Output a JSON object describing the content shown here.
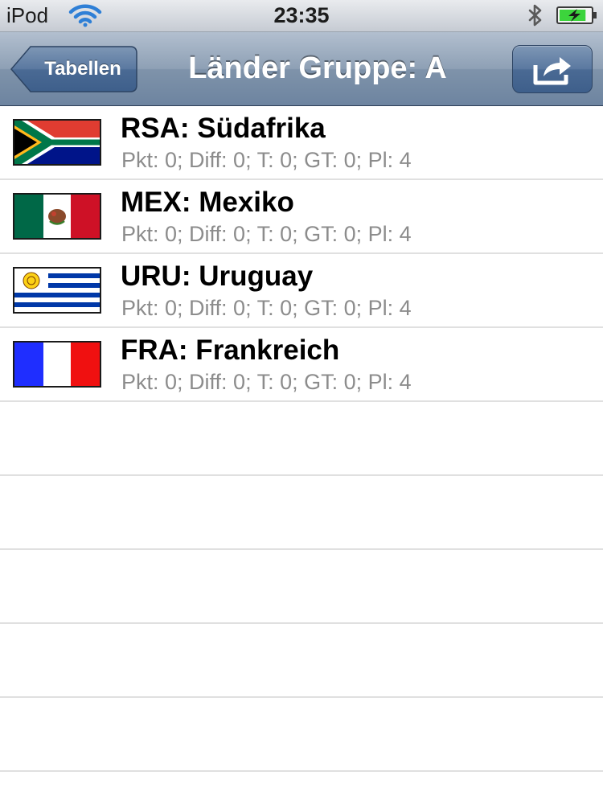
{
  "status_bar": {
    "carrier": "iPod",
    "time": "23:35",
    "wifi_icon": "wifi-icon",
    "bluetooth_icon": "bluetooth-icon",
    "battery_icon": "battery-charging-icon",
    "battery_level": 0.85
  },
  "nav_bar": {
    "back_label": "Tabellen",
    "title": "Länder Gruppe: A",
    "action_icon": "share-icon"
  },
  "teams": [
    {
      "name": "RSA: Südafrika",
      "stats": "Pkt: 0; Diff: 0; T: 0; GT: 0; Pl: 4",
      "flag_icon": "south-africa-flag-icon"
    },
    {
      "name": "MEX: Mexiko",
      "stats": "Pkt: 0; Diff: 0; T: 0; GT: 0; Pl: 4",
      "flag_icon": "mexico-flag-icon"
    },
    {
      "name": "URU: Uruguay",
      "stats": "Pkt: 0; Diff: 0; T: 0; GT: 0; Pl: 4",
      "flag_icon": "uruguay-flag-icon"
    },
    {
      "name": "FRA: Frankreich",
      "stats": "Pkt: 0; Diff: 0; T: 0; GT: 0; Pl: 4",
      "flag_icon": "france-flag-icon"
    }
  ],
  "colors": {
    "nav_bar": "#8ea0b5",
    "title_text": "#000000",
    "subtitle_text": "#8c8c8c",
    "battery_fill": "#3cd43c"
  }
}
